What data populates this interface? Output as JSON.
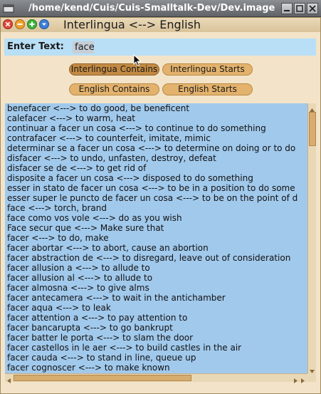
{
  "os_window": {
    "title": "/home/kend/Cuis/Cuis-Smalltalk-Dev/Dev.image"
  },
  "window": {
    "title": "Interlingua <--> English"
  },
  "input": {
    "label": "Enter Text:",
    "value": "face"
  },
  "buttons": {
    "interlingua_contains": "Interlingua Contains",
    "interlingua_starts": "Interlingua Starts",
    "english_contains": "English Contains",
    "english_starts": "English Starts"
  },
  "results": [
    "benefacer <---> to do good, be beneficent",
    "calefacer <---> to warm, heat",
    "continuar a facer un cosa <---> to continue to do something",
    "contrafacer <---> to counterfeit, imitate, mimic",
    "determinar se a facer un cosa <---> to determine on doing or to do",
    "disfacer <---> to undo, unfasten, destroy, defeat",
    "disfacer se de <---> to get rid of",
    "disposite a facer un cosa <---> disposed to do something",
    "esser in stato de facer un cosa <---> to be in a position to do some",
    "esser super le puncto de facer un cosa <---> to be on the point of d",
    "face <---> torch, brand",
    "face como vos vole <---> do as you wish",
    "Face secur que <---> Make sure that",
    "facer <---> to do, make",
    "facer abortar <---> to abort, cause an abortion",
    "facer abstraction de <---> to disregard, leave out of consideration",
    "facer allusion a <---> to allude to",
    "facer allusion al <---> to allude to",
    "facer almosna <---> to give alms",
    "facer antecamera <---> to wait in the antichamber",
    "facer aqua <---> to leak",
    "facer attention a <---> to pay attention to",
    "facer bancarupta <---> to go bankrupt",
    "facer batter le porta <---> to slam the door",
    "facer castellos in le aer <---> to build castles in the air",
    "facer cauda <---> to stand in line, queue up",
    "facer cognoscer <---> to make known"
  ],
  "icons": {
    "window_menu": "window-menu-icon",
    "close": "close-icon",
    "collapse": "collapse-icon",
    "expand": "expand-icon",
    "window_menu_morph": "menu-icon"
  },
  "colors": {
    "window_bg": "#f3e4c9",
    "list_bg": "#a1c9ec",
    "button": "#e3b26d",
    "button_pressed": "#c38a43",
    "input_row": "#b8dff5"
  }
}
